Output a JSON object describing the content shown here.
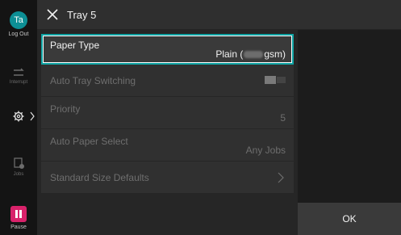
{
  "header": {
    "title": "Tray 5"
  },
  "rail": {
    "user_initials": "Ta",
    "logout_label": "Log Out",
    "interrupt_label": "Interrupt",
    "jobs_label": "Jobs",
    "pause_label": "Pause"
  },
  "settings": [
    {
      "label": "Paper Type",
      "value_prefix": "Plain (",
      "value_suffix": "gsm)",
      "selected": true
    },
    {
      "label": "Auto Tray Switching"
    },
    {
      "label": "Priority",
      "value": "5"
    },
    {
      "label": "Auto Paper Select",
      "value": "Any Jobs"
    },
    {
      "label": "Standard Size Defaults"
    }
  ],
  "actions": {
    "ok_label": "OK"
  },
  "colors": {
    "accent": "#0fa3a3",
    "avatar": "#0d8f95",
    "pause": "#d8226a"
  }
}
